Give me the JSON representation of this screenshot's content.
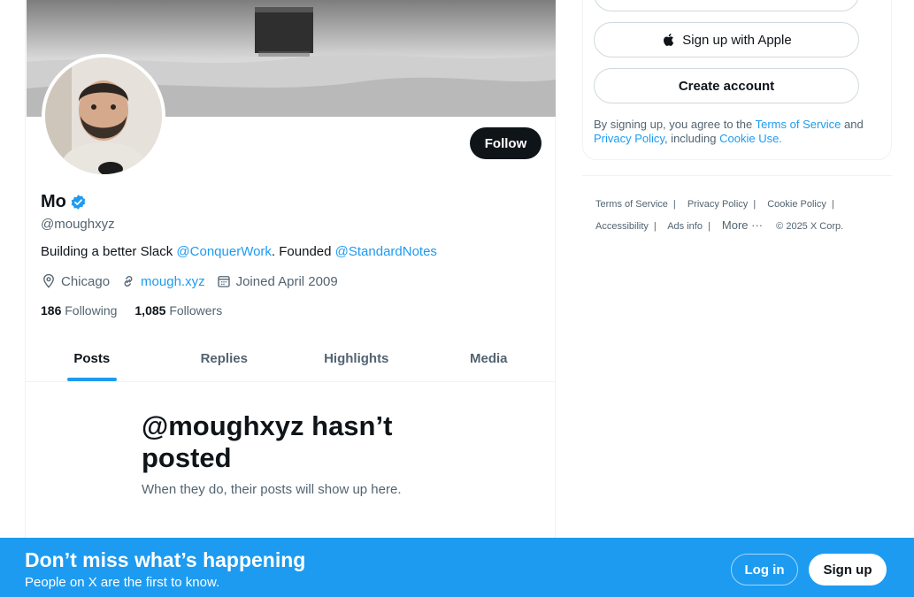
{
  "profile": {
    "name": "Mo",
    "handle": "@moughxyz",
    "bio_prefix": "Building a better Slack ",
    "bio_mention_1": "@ConquerWork",
    "bio_middle": ". Founded ",
    "bio_mention_2": "@StandardNotes",
    "location": "Chicago",
    "website": "mough.xyz",
    "joined": "Joined April 2009",
    "following_count": "186",
    "following_label": "Following",
    "followers_count": "1,085",
    "followers_label": "Followers",
    "follow_label": "Follow"
  },
  "tabs": [
    {
      "label": "Posts",
      "active": true
    },
    {
      "label": "Replies",
      "active": false
    },
    {
      "label": "Highlights",
      "active": false
    },
    {
      "label": "Media",
      "active": false
    }
  ],
  "empty_state": {
    "title": "@moughxyz hasn’t posted",
    "subtitle": "When they do, their posts will show up here."
  },
  "sidebar": {
    "apple_label": "Sign up with Apple",
    "create_label": "Create account",
    "legal_prefix": "By signing up, you agree to the ",
    "terms": "Terms of Service",
    "and": " and ",
    "privacy": "Privacy Policy",
    "including": ", including ",
    "cookie": "Cookie Use."
  },
  "footer": {
    "terms": "Terms of Service",
    "privacy": "Privacy Policy",
    "cookie": "Cookie Policy",
    "accessibility": "Accessibility",
    "ads": "Ads info",
    "more": "More ···",
    "copyright": "© 2025 X Corp."
  },
  "bottom_bar": {
    "title": "Don’t miss what’s happening",
    "subtitle": "People on X are the first to know.",
    "login": "Log in",
    "signup": "Sign up"
  },
  "colors": {
    "accent": "#1d9bf0",
    "text": "#0f1419",
    "muted": "#536471"
  },
  "icons": [
    "verified-badge-icon",
    "location-icon",
    "link-icon",
    "calendar-icon",
    "apple-icon",
    "google-icon"
  ]
}
